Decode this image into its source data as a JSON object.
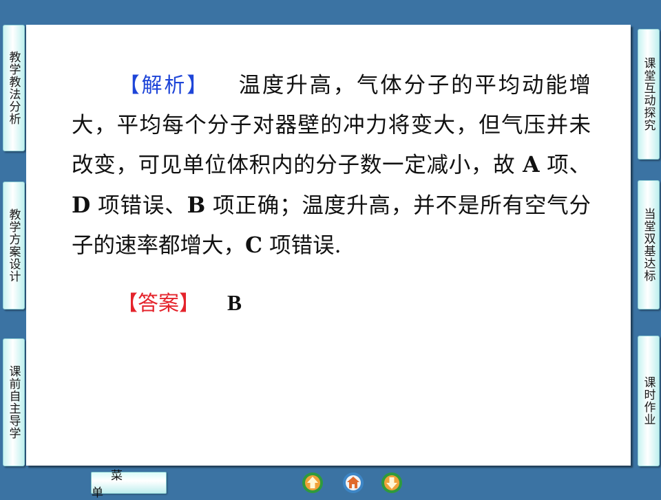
{
  "content": {
    "analysis_label": "【解析】",
    "analysis_text": "温度升高，气体分子的平均动能增大，平均每个分子对器壁的冲力将变大，但气压并未改变，可见单位体积内的分子数一定减小，故",
    "analysis_opt_a": "A",
    "analysis_t2": " 项、",
    "analysis_opt_d": "D",
    "analysis_t3": " 项错误、",
    "analysis_opt_b": "B",
    "analysis_t4": " 项正确；温度升高，并不是所有空气分子的速率都增大，",
    "analysis_opt_c": "C",
    "analysis_t5": " 项错误.",
    "answer_label": "【答案】",
    "answer_value": "B"
  },
  "left_tabs": [
    "教学教法分析",
    "教学方案设计",
    "课前自主导学"
  ],
  "right_tabs": [
    "课堂互动探究",
    "当堂双基达标",
    "课时作业"
  ],
  "bottom_bar": {
    "menu_label": "菜单"
  },
  "nav_icons": [
    "prev-arrow-icon",
    "home-icon",
    "next-arrow-icon"
  ],
  "colors": {
    "background": "#3b73a3",
    "label_blue": "#1e45d8",
    "label_red": "#e4232b",
    "tab_fill": "#c8f3f1",
    "nav_orange": "#f0a23a",
    "nav_green": "#2f9a3c"
  }
}
